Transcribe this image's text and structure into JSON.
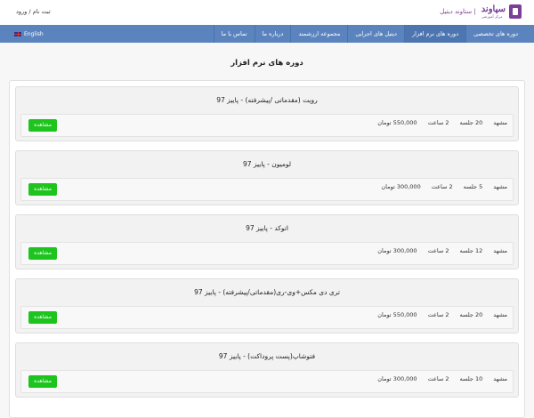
{
  "header": {
    "logo_main": "سپاوند",
    "logo_sub": "مرکز آموزشی",
    "site_name": "| ستاوند دیتیل",
    "auth": "ثبت نام / ورود"
  },
  "nav": {
    "items": [
      {
        "label": "دوره های تخصصی"
      },
      {
        "label": "دوره های نرم افزار"
      },
      {
        "label": "دیتیل های اجرایی"
      },
      {
        "label": "مجموعه ارزشمند"
      },
      {
        "label": "درباره ما"
      },
      {
        "label": "تماس با ما"
      }
    ],
    "language": "English"
  },
  "page": {
    "title": "دوره های نرم افزار"
  },
  "courses": [
    {
      "title": "رویت (مقدماتی /پیشرفته) - پاییز 97",
      "city": "مشهد",
      "sessions": "20 جلسه",
      "hours": "2 ساعت",
      "price": "550,000 تومان",
      "button": "مشاهده"
    },
    {
      "title": "لومیون - پاییز 97",
      "city": "مشهد",
      "sessions": "5 جلسه",
      "hours": "2 ساعت",
      "price": "300,000 تومان",
      "button": "مشاهده"
    },
    {
      "title": "اتوکد - پاییز 97",
      "city": "مشهد",
      "sessions": "12 جلسه",
      "hours": "2 ساعت",
      "price": "300,000 تومان",
      "button": "مشاهده"
    },
    {
      "title": "تری دی مکس+وی-ری(مقدماتی/پیشرفته) - پاییز 97",
      "city": "مشهد",
      "sessions": "20 جلسه",
      "hours": "2 ساعت",
      "price": "550,000 تومان",
      "button": "مشاهده"
    },
    {
      "title": "فتوشاپ(پست پروداکت) - پاییز 97",
      "city": "مشهد",
      "sessions": "10 جلسه",
      "hours": "2 ساعت",
      "price": "300,000 تومان",
      "button": "مشاهده"
    }
  ],
  "colors": {
    "nav_bg": "#5b84bf",
    "brand": "#7b3f98",
    "button": "#1ec41e"
  }
}
